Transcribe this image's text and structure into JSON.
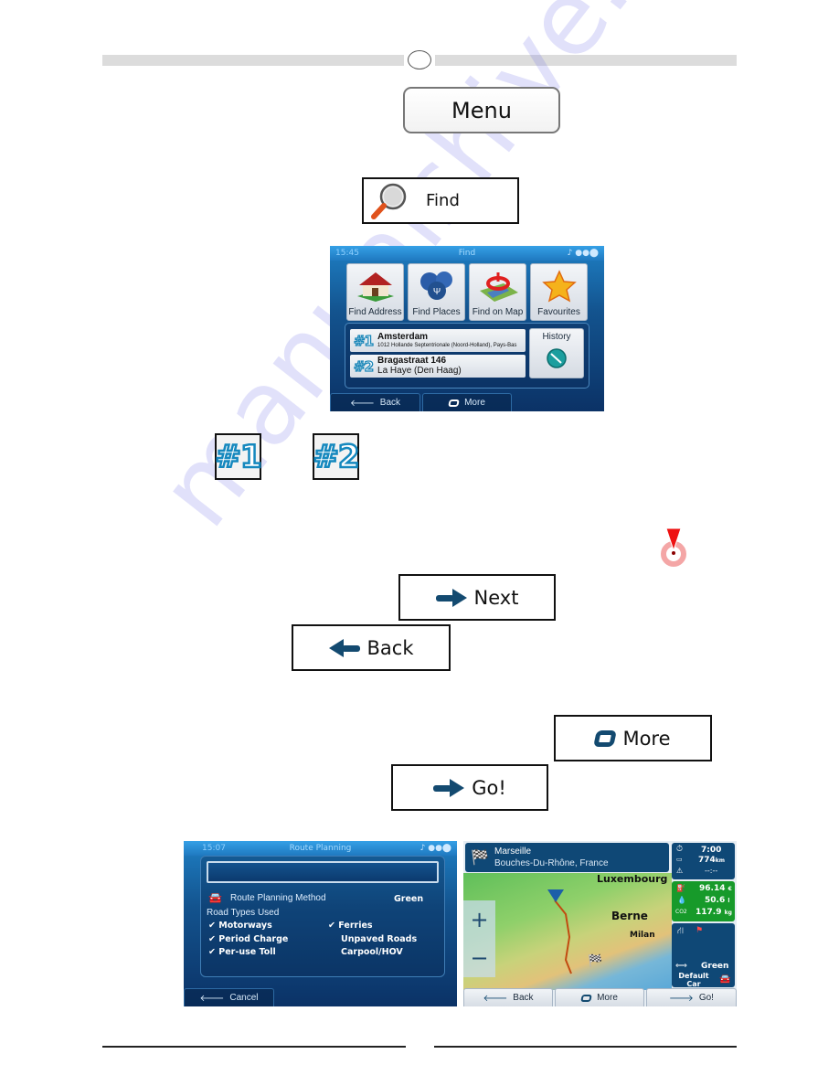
{
  "header": {
    "page_marker": ""
  },
  "buttons": {
    "menu": "Menu",
    "find": "Find",
    "next": "Next",
    "back": "Back",
    "more": "More",
    "go": "Go!"
  },
  "find_screen": {
    "time": "15:45",
    "title": "Find",
    "tiles": [
      {
        "label": "Find Address",
        "icon": "house-icon"
      },
      {
        "label": "Find Places",
        "icon": "places-pins-icon"
      },
      {
        "label": "Find on Map",
        "icon": "map-pin-icon"
      },
      {
        "label": "Favourites",
        "icon": "star-icon"
      }
    ],
    "history": [
      {
        "rank": "#1",
        "title": "Amsterdam",
        "subtitle": "1012 Hollande Septentrionale (Noord-Holland), Pays-Bas"
      },
      {
        "rank": "#2",
        "title": "Bragastraat 146",
        "subtitle": "La Haye (Den Haag)"
      }
    ],
    "history_button": "History",
    "bottom": {
      "back": "Back",
      "more": "More"
    }
  },
  "rank_icons": [
    "#1",
    "#2"
  ],
  "watermark": "manualshive.com",
  "route_planning": {
    "time": "15:07",
    "title": "Route Planning",
    "method_label": "Route Planning Method",
    "method_value": "Green",
    "road_types_heading": "Road Types Used",
    "road_types": [
      {
        "label": "Motorways",
        "checked": true
      },
      {
        "label": "Ferries",
        "checked": true
      },
      {
        "label": "Period Charge",
        "checked": true
      },
      {
        "label": "Unpaved Roads",
        "checked": false
      },
      {
        "label": "Per-use Toll",
        "checked": true
      },
      {
        "label": "Carpool/HOV",
        "checked": false
      }
    ],
    "cancel": "Cancel"
  },
  "route_map": {
    "destination": "Marseille",
    "destination_sub": "Bouches-Du-Rhône, France",
    "cities": [
      "Luxembourg",
      "Berne",
      "Milan"
    ],
    "time": "7:00",
    "distance": "774",
    "distance_unit": "km",
    "eta": "--:--",
    "cost": "96.14",
    "cost_unit": "€",
    "fuel": "50.6",
    "fuel_unit": "l",
    "co2_label": "CO2",
    "co2": "117.9",
    "co2_unit": "kg",
    "method": "Green",
    "vehicle": "Default Car",
    "bottom": {
      "back": "Back",
      "more": "More",
      "go": "Go!"
    },
    "zoom_in": "+",
    "zoom_out": "−"
  }
}
